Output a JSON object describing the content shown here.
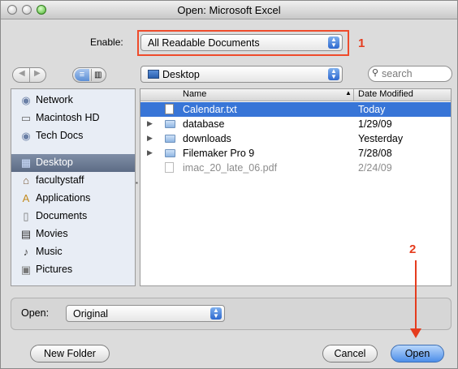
{
  "window": {
    "title": "Open: Microsoft Excel"
  },
  "enable": {
    "label": "Enable:",
    "value": "All Readable Documents"
  },
  "location": {
    "value": "Desktop"
  },
  "search": {
    "placeholder": "search"
  },
  "annotations": {
    "step1": "1",
    "step2": "2"
  },
  "sidebar": {
    "items": [
      {
        "label": "Network",
        "icon": "network-icon"
      },
      {
        "label": "Macintosh HD",
        "icon": "hard-drive-icon"
      },
      {
        "label": "Tech Docs",
        "icon": "network-volume-icon"
      },
      {
        "label": "Desktop",
        "icon": "desktop-icon",
        "selected": true
      },
      {
        "label": "facultystaff",
        "icon": "home-icon"
      },
      {
        "label": "Applications",
        "icon": "applications-icon"
      },
      {
        "label": "Documents",
        "icon": "documents-icon"
      },
      {
        "label": "Movies",
        "icon": "movies-icon"
      },
      {
        "label": "Music",
        "icon": "music-icon"
      },
      {
        "label": "Pictures",
        "icon": "pictures-icon"
      }
    ]
  },
  "files": {
    "columns": {
      "name": "Name",
      "date": "Date Modified"
    },
    "rows": [
      {
        "name": "Calendar.txt",
        "date": "Today",
        "type": "document",
        "selected": true
      },
      {
        "name": "database",
        "date": "1/29/09",
        "type": "folder"
      },
      {
        "name": "downloads",
        "date": "Yesterday",
        "type": "folder"
      },
      {
        "name": "Filemaker Pro 9",
        "date": "7/28/08",
        "type": "folder"
      },
      {
        "name": "imac_20_late_06.pdf",
        "date": "2/24/09",
        "type": "document",
        "disabled": true
      }
    ]
  },
  "open_options": {
    "label": "Open:",
    "value": "Original"
  },
  "buttons": {
    "new_folder": "New Folder",
    "cancel": "Cancel",
    "open": "Open"
  },
  "colors": {
    "accent": "#3875d7",
    "annotation": "#e53c1e",
    "sidebar_selected": "#6a7a93"
  }
}
